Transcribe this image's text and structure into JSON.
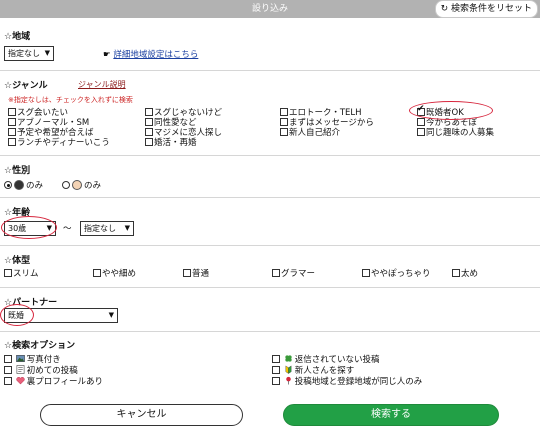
{
  "header": {
    "title": "設り込み",
    "reset_label": "検索条件をリセット"
  },
  "area": {
    "title": "☆地域",
    "select_value": "指定なし",
    "detail_link": "詳細地域設定はこちら"
  },
  "genre": {
    "title": "☆ジャンル",
    "help_link": "ジャンル説明",
    "note": "※指定なしは、チェックを入れずに検索",
    "items": [
      {
        "label": "スグ会いたい",
        "checked": false
      },
      {
        "label": "アブノーマル・SM",
        "checked": false
      },
      {
        "label": "予定や希望が合えば",
        "checked": false
      },
      {
        "label": "ランチやディナーいこう",
        "checked": false
      },
      {
        "label": "スグじゃないけど",
        "checked": false
      },
      {
        "label": "同性愛など",
        "checked": false
      },
      {
        "label": "マジメに恋人探し",
        "checked": false
      },
      {
        "label": "婚活・再婚",
        "checked": false
      },
      {
        "label": "エロトーク・TELH",
        "checked": false
      },
      {
        "label": "まずはメッセージから",
        "checked": false
      },
      {
        "label": "新人自己紹介",
        "checked": false
      },
      {
        "label": "既婚者OK",
        "checked": true
      },
      {
        "label": "今からあそぼ",
        "checked": false
      },
      {
        "label": "同じ趣味の人募集",
        "checked": false
      }
    ]
  },
  "gender": {
    "title": "☆性別",
    "female_label": "のみ",
    "male_label": "のみ"
  },
  "age": {
    "title": "☆年齢",
    "from_value": "30歳",
    "separator": "〜",
    "to_value": "指定なし"
  },
  "body_type": {
    "title": "☆体型",
    "items": [
      "スリム",
      "やや細め",
      "普通",
      "グラマー",
      "ややぽっちゃり",
      "太め"
    ]
  },
  "partner": {
    "title": "☆パートナー",
    "select_value": "既婚"
  },
  "options": {
    "title": "☆検索オプション",
    "left": [
      "写真付き",
      "初めての投稿",
      "裏プロフィールあり"
    ],
    "right": [
      "返信されていない投稿",
      "新人さんを探す",
      "投稿地域と登録地域が同じ人のみ"
    ]
  },
  "footer": {
    "cancel_label": "キャンセル",
    "search_label": "検索する"
  },
  "colors": {
    "accent_green": "#22a046",
    "highlight_red": "#d7263d",
    "header_gray": "#b2b2b2"
  }
}
